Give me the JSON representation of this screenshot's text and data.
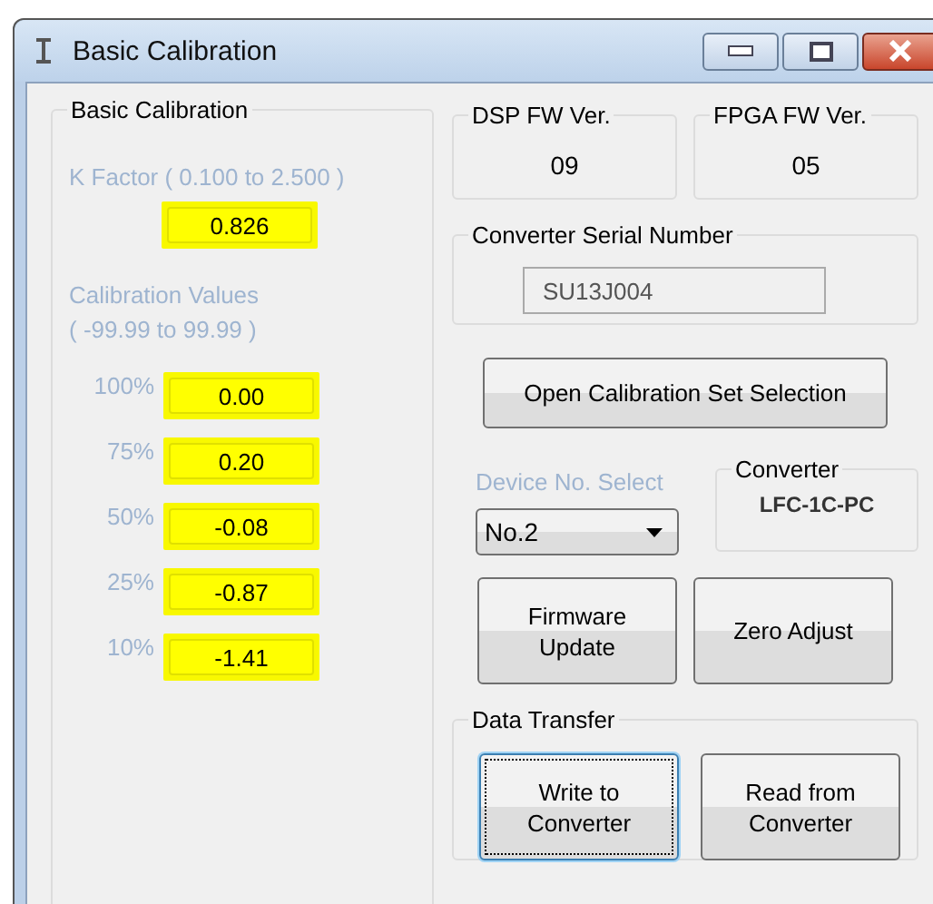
{
  "window": {
    "title": "Basic Calibration"
  },
  "basic_calibration": {
    "title": "Basic Calibration",
    "k_factor_label": "K Factor ( 0.100 to 2.500 )",
    "k_factor": "0.826",
    "values_label": [
      "Calibration Values",
      "( -99.99 to 99.99 )"
    ],
    "rows": [
      {
        "label": "100%",
        "value": "0.00"
      },
      {
        "label": "75%",
        "value": "0.20"
      },
      {
        "label": "50%",
        "value": "-0.08"
      },
      {
        "label": "25%",
        "value": "-0.87"
      },
      {
        "label": "10%",
        "value": "-1.41"
      }
    ]
  },
  "dsp_fw": {
    "title": "DSP FW Ver.",
    "value": "09"
  },
  "fpga_fw": {
    "title": "FPGA FW Ver.",
    "value": "05"
  },
  "serial": {
    "title": "Converter Serial Number",
    "value": "SU13J004"
  },
  "open_button": "Open Calibration Set Selection",
  "device_select": {
    "label": "Device No. Select",
    "value": "No.2"
  },
  "converter": {
    "title": "Converter",
    "value": "LFC-1C-PC"
  },
  "buttons": [
    "Firmware\nUpdate",
    "Zero Adjust"
  ],
  "data_transfer": {
    "title": "Data Transfer",
    "buttons": [
      {
        "label": "Write to\nConverter",
        "focused": true
      },
      {
        "label": "Read from\nConverter",
        "focused": false
      }
    ]
  }
}
